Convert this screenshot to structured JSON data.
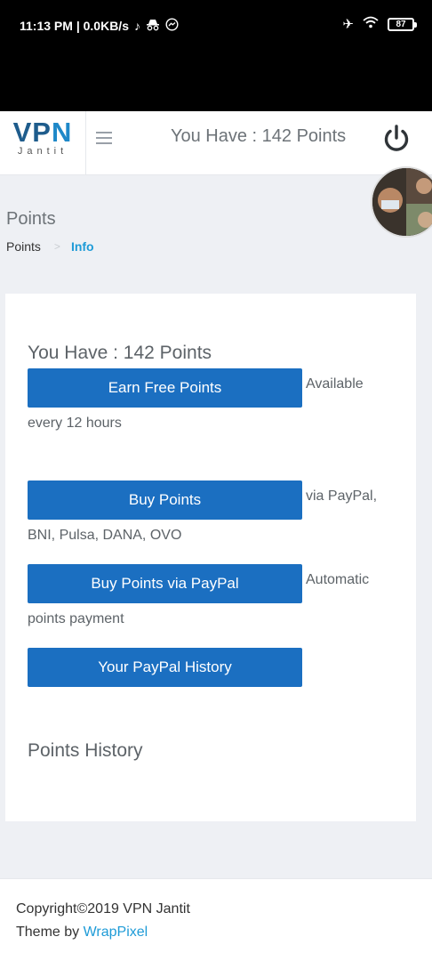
{
  "status_bar": {
    "time_speed": "11:13 PM | 0.0KB/s",
    "battery": "87",
    "icons": [
      "tiktok-icon",
      "incognito-icon",
      "messenger-icon",
      "airplane-icon",
      "wifi-icon",
      "battery-icon"
    ]
  },
  "header": {
    "logo_main_v": "VP",
    "logo_main_n": "N",
    "logo_sub": "Jantit",
    "points_text": "You Have : 142 Points"
  },
  "page": {
    "title": "Points",
    "breadcrumb_home": "Points",
    "breadcrumb_active": "Info"
  },
  "card": {
    "heading": "You Have : 142 Points",
    "rows": [
      {
        "button": "Earn Free Points",
        "text": "Available every 12 hours"
      },
      {
        "button": "Buy Points",
        "text": "via PayPal, BNI, Pulsa, DANA, OVO"
      },
      {
        "button": "Buy Points via PayPal",
        "text": "Automatic points payment"
      },
      {
        "button": "Your PayPal History",
        "text": ""
      }
    ],
    "history_heading": "Points History"
  },
  "footer": {
    "copyright": "Copyright©2019 VPN Jantit",
    "theme_by": "Theme by",
    "link": "WrapPixel"
  },
  "colors": {
    "primary_button": "#1b6fc1",
    "link": "#1e9bd7",
    "logo_dark": "#1e5c8c",
    "background": "#eef0f4"
  }
}
